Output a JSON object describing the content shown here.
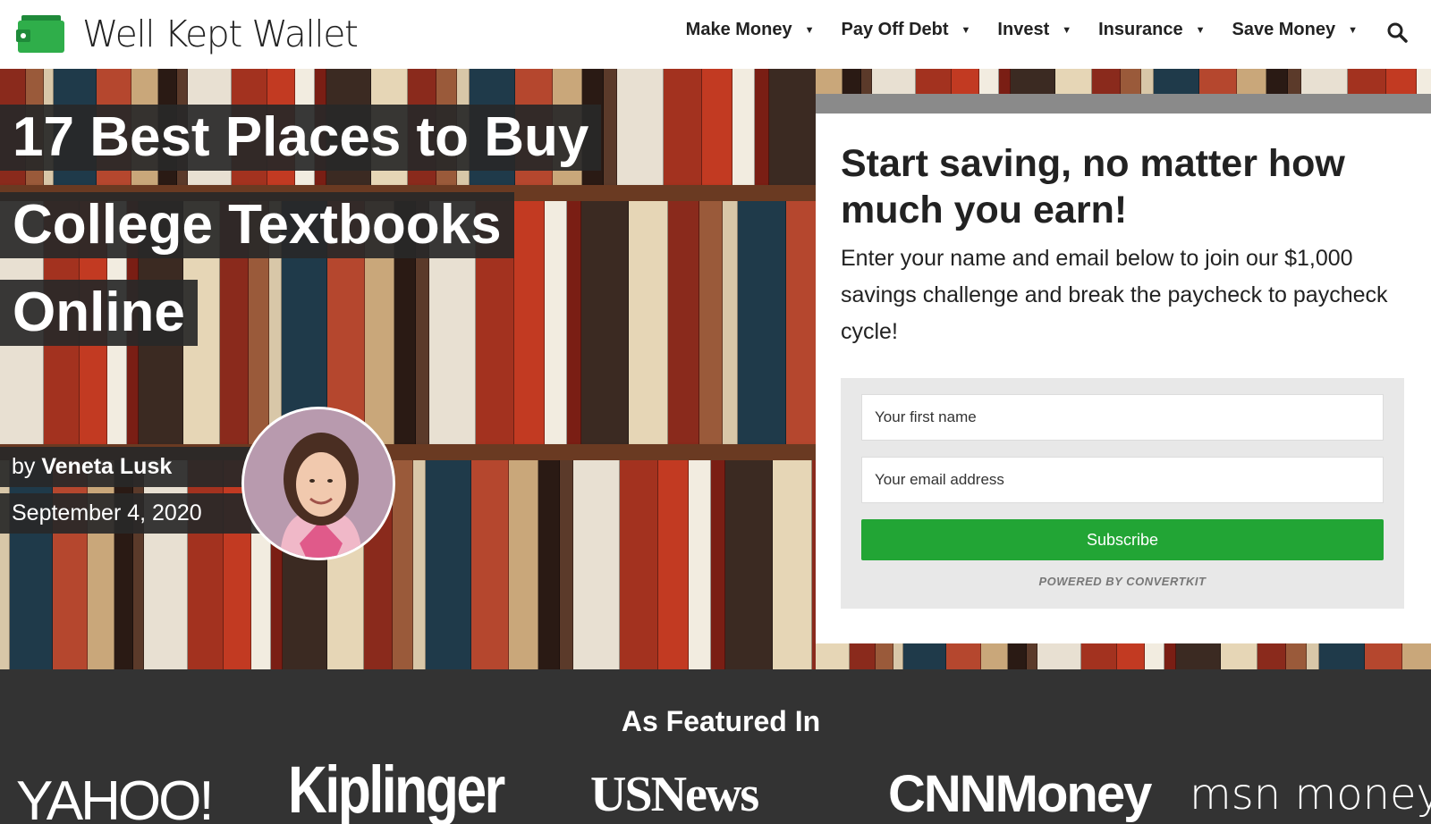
{
  "site": {
    "name": "Well Kept Wallet",
    "logo_icon": "wallet-icon",
    "brand_color": "#2fae4a"
  },
  "nav": {
    "items": [
      {
        "label": "Make Money"
      },
      {
        "label": "Pay Off Debt"
      },
      {
        "label": "Invest"
      },
      {
        "label": "Insurance"
      },
      {
        "label": "Save Money"
      }
    ],
    "search_icon": "search-icon"
  },
  "article": {
    "title_lines": [
      "17 Best Places to Buy",
      "College Textbooks",
      "Online"
    ],
    "by_prefix": "by",
    "author": "Veneta Lusk",
    "date": "September 4, 2020"
  },
  "optin": {
    "headline": "Start saving, no matter how much you earn!",
    "description": "Enter your name and email below to join our $1,000 savings challenge and break the paycheck to paycheck cycle!",
    "first_name_placeholder": "Your first name",
    "email_placeholder": "Your email address",
    "button_label": "Subscribe",
    "button_color": "#22a535",
    "powered_by": "POWERED BY CONVERTKIT"
  },
  "featured": {
    "title": "As Featured In",
    "publications": [
      {
        "name": "YAHOO!"
      },
      {
        "name": "Kiplinger"
      },
      {
        "name": "USNews"
      },
      {
        "name": "CNNMoney"
      },
      {
        "name": "msn money"
      }
    ]
  }
}
